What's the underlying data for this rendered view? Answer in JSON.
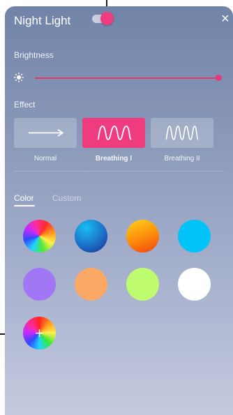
{
  "header": {
    "title": "Night Light",
    "toggle_on": true,
    "close_icon": "close-icon"
  },
  "brightness": {
    "label": "Brightness",
    "icon": "sun-icon",
    "value": 1.0
  },
  "effect": {
    "label": "Effect",
    "options": [
      {
        "label": "Normal",
        "icon": "arrow-right-icon",
        "active": false
      },
      {
        "label": "Breathing I",
        "icon": "wave-icon",
        "active": true
      },
      {
        "label": "Breathing II",
        "icon": "fast-wave-icon",
        "active": false
      }
    ]
  },
  "tabs": [
    {
      "label": "Color",
      "active": true
    },
    {
      "label": "Custom",
      "active": false
    }
  ],
  "colors": {
    "swatches": [
      {
        "name": "rainbow"
      },
      {
        "name": "blue",
        "hex": "#1a70c8"
      },
      {
        "name": "orange",
        "hex": "#f98a0e"
      },
      {
        "name": "cyan",
        "hex": "#00c4f8"
      },
      {
        "name": "purple",
        "hex": "#a277f6"
      },
      {
        "name": "peach",
        "hex": "#fca865"
      },
      {
        "name": "lime",
        "hex": "#bffb6e"
      },
      {
        "name": "white",
        "hex": "#ffffff"
      }
    ],
    "add_icon": "plus-icon"
  },
  "accent": "#ee3c7e"
}
